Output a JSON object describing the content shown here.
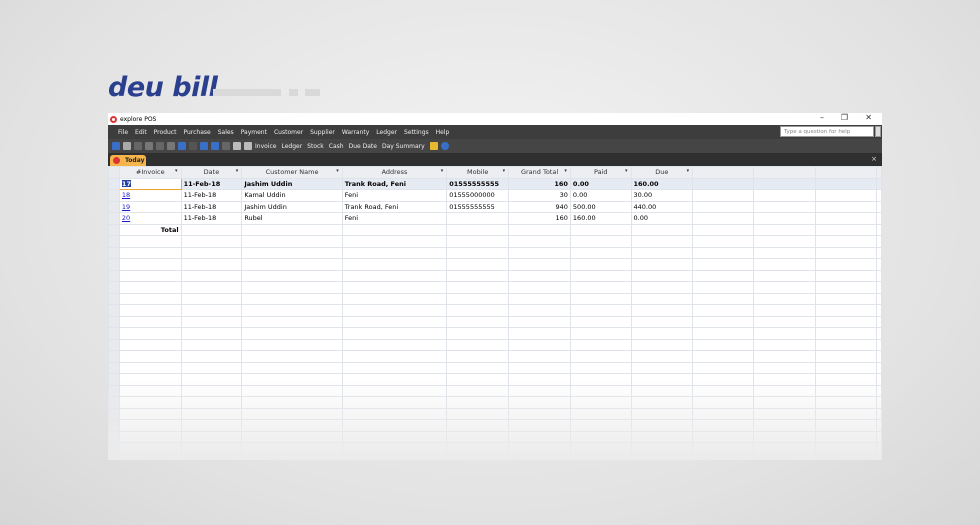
{
  "brand": {
    "logo_text": "deu bill"
  },
  "window": {
    "title": "explore POS",
    "minimize": "–",
    "restore": "❐",
    "close": "✕"
  },
  "menu": [
    "File",
    "Edit",
    "Product",
    "Purchase",
    "Sales",
    "Payment",
    "Customer",
    "Supplier",
    "Warranty",
    "Ledger",
    "Settings",
    "Help"
  ],
  "help_placeholder": "Type a question for help",
  "toolbar": {
    "invoice": "Invoice",
    "ledger": "Ledger",
    "stock": "Stock",
    "cash": "Cash",
    "due_date": "Due Date",
    "day_summary": "Day Summary"
  },
  "tab": {
    "label": "Today",
    "close": "×"
  },
  "grid": {
    "columns": [
      "#Invoice",
      "Date",
      "Customer Name",
      "Address",
      "Mobile",
      "Grand Total",
      "Paid",
      "Due"
    ],
    "rows": [
      [
        "17",
        "11-Feb-18",
        "Jashim Uddin",
        "Trank Road, Feni",
        "01555555555",
        "160",
        "0.00",
        "160.00"
      ],
      [
        "18",
        "11-Feb-18",
        "Kamal Uddin",
        "Feni",
        "01555000000",
        "30",
        "0.00",
        "30.00"
      ],
      [
        "19",
        "11-Feb-18",
        "Jashim Uddin",
        "Trank Road, Feni",
        "01555555555",
        "940",
        "500.00",
        "440.00"
      ],
      [
        "20",
        "11-Feb-18",
        "Rubel",
        "Feni",
        "",
        "160",
        "160.00",
        "0.00"
      ]
    ],
    "total_label": "Total"
  }
}
